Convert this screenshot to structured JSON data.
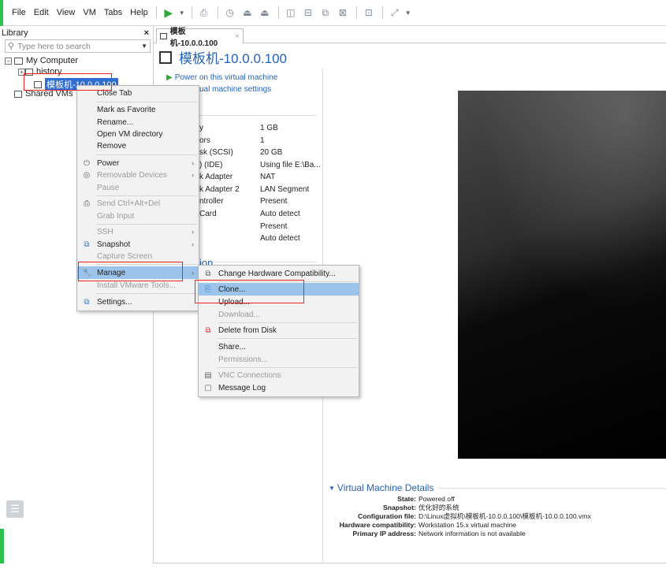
{
  "menubar": {
    "items": [
      "File",
      "Edit",
      "View",
      "VM",
      "Tabs",
      "Help"
    ]
  },
  "library": {
    "title": "Library",
    "close": "×",
    "search_placeholder": "Type here to search",
    "tree": {
      "my_computer": "My Computer",
      "history": "history",
      "selected_vm": "模板机-10.0.0.100",
      "shared": "Shared VMs"
    }
  },
  "tab": {
    "label": "模板机-10.0.0.100",
    "close": "×"
  },
  "vm": {
    "title": "模板机-10.0.0.100",
    "power_on": "Power on this virtual machine",
    "settings_partial": "ual machine settings",
    "devices": [
      {
        "name": "y",
        "value": "1 GB"
      },
      {
        "name": "ors",
        "value": "1"
      },
      {
        "name": "sk (SCSI)",
        "value": "20 GB"
      },
      {
        "name": ") (IDE)",
        "value": "Using file E:\\Ba..."
      },
      {
        "name": "k Adapter",
        "value": "NAT"
      },
      {
        "name": "k Adapter 2",
        "value": "LAN Segment"
      },
      {
        "name": "ntroller",
        "value": "Present"
      },
      {
        "name": "Card",
        "value": "Auto detect"
      },
      {
        "name": "",
        "value": "Present"
      },
      {
        "name": "",
        "value": "Auto detect"
      }
    ],
    "section_partial": "ion"
  },
  "details": {
    "title": "Virtual Machine Details",
    "rows": [
      {
        "key": "State:",
        "value": "Powered off"
      },
      {
        "key": "Snapshot:",
        "value": "优化好的系统"
      },
      {
        "key": "Configuration file:",
        "value": "D:\\Linux虚拟机\\模板机-10.0.0.100\\模板机-10.0.0.100.vmx"
      },
      {
        "key": "Hardware compatibility:",
        "value": "Workstation 15.x virtual machine"
      },
      {
        "key": "Primary IP address:",
        "value": "Network information is not available"
      }
    ]
  },
  "context_menu": {
    "items": [
      {
        "label": "Close Tab"
      },
      {
        "label": "Mark as Favorite"
      },
      {
        "label": "Rename..."
      },
      {
        "label": "Open VM directory"
      },
      {
        "label": "Remove"
      },
      {
        "label": "Power"
      },
      {
        "label": "Removable Devices"
      },
      {
        "label": "Pause"
      },
      {
        "label": "Send Ctrl+Alt+Del"
      },
      {
        "label": "Grab Input"
      },
      {
        "label": "SSH"
      },
      {
        "label": "Snapshot"
      },
      {
        "label": "Capture Screen"
      },
      {
        "label": "Manage"
      },
      {
        "label": "Install VMware Tools..."
      },
      {
        "label": "Settings..."
      }
    ]
  },
  "manage_submenu": {
    "items": [
      {
        "label": "Change Hardware Compatibility..."
      },
      {
        "label": "Clone..."
      },
      {
        "label": "Upload..."
      },
      {
        "label": "Download..."
      },
      {
        "label": "Delete from Disk"
      },
      {
        "label": "Share..."
      },
      {
        "label": "Permissions..."
      },
      {
        "label": "VNC Connections"
      },
      {
        "label": "Message Log"
      }
    ]
  },
  "colors": {
    "accent_green": "#2fc24a",
    "link_blue": "#2463b8",
    "highlight": "#9cc3ea",
    "annotation_red": "#e22222"
  }
}
